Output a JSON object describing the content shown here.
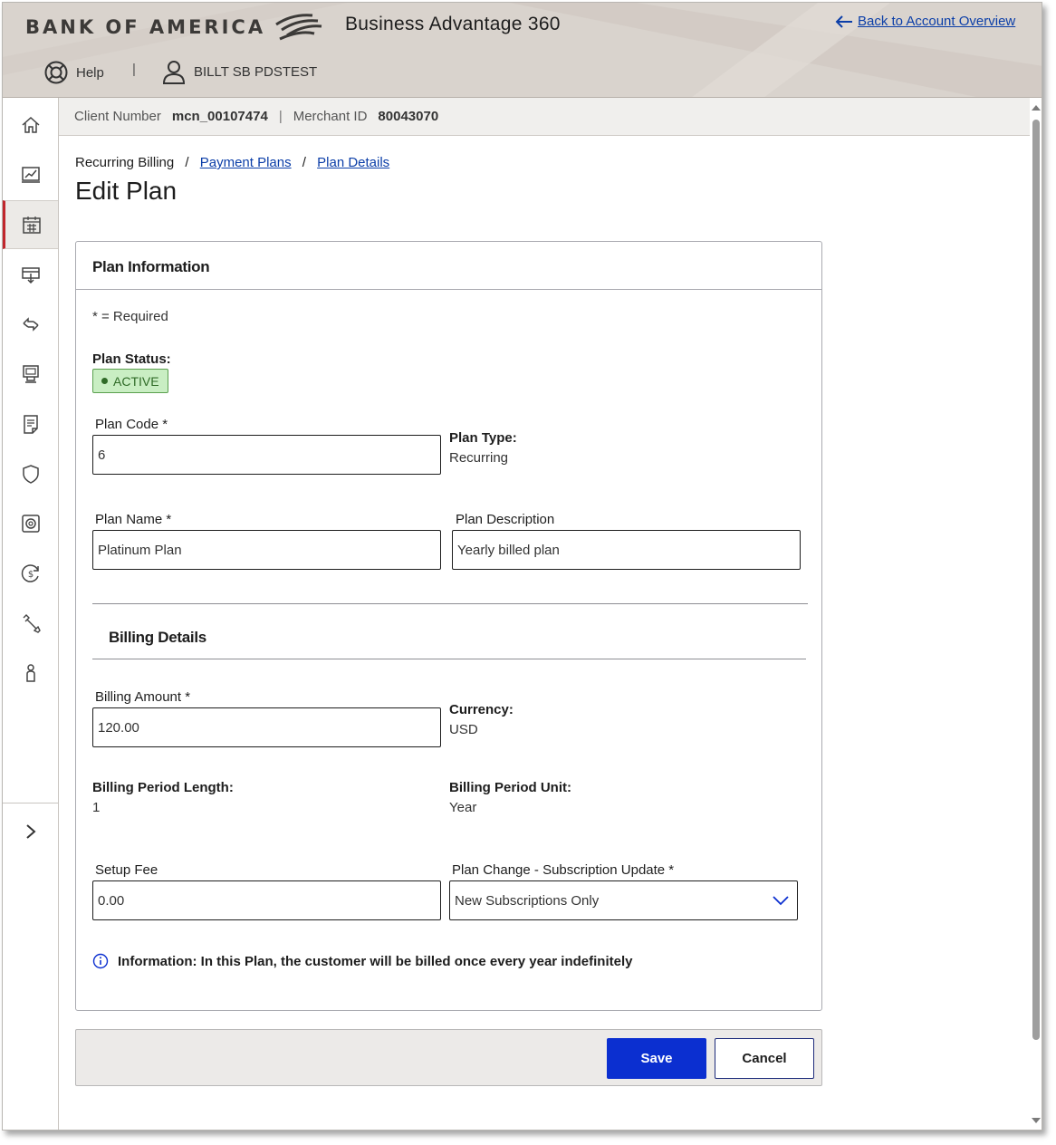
{
  "header": {
    "logo_text": "BANK OF AMERICA",
    "product_name": "Business Advantage 360",
    "back_link": "Back to Account Overview",
    "help_label": "Help",
    "separator": "|",
    "user_name": "BILLT SB PDSTEST"
  },
  "infobar": {
    "client_label": "Client Number",
    "client_value": "mcn_00107474",
    "separator": "|",
    "merchant_label": "Merchant ID",
    "merchant_value": "80043070"
  },
  "sidebar": {
    "items": [
      {
        "icon": "home-icon"
      },
      {
        "icon": "chart-icon"
      },
      {
        "icon": "calendar-icon",
        "active": true
      },
      {
        "icon": "deposit-icon"
      },
      {
        "icon": "transfer-icon"
      },
      {
        "icon": "terminal-icon"
      },
      {
        "icon": "document-icon"
      },
      {
        "icon": "shield-icon"
      },
      {
        "icon": "safe-icon"
      },
      {
        "icon": "dollar-cycle-icon"
      },
      {
        "icon": "tools-icon"
      },
      {
        "icon": "person-icon"
      }
    ],
    "expand_icon": "chevron-right-icon"
  },
  "breadcrumb": {
    "root": "Recurring Billing",
    "separator": "/",
    "payment_plans": "Payment Plans",
    "plan_details": "Plan Details"
  },
  "page_title": "Edit Plan",
  "plan_info": {
    "title": "Plan Information",
    "required_note": "* = Required",
    "status_label": "Plan Status:",
    "status_value": "ACTIVE",
    "plan_code_label": "Plan Code *",
    "plan_code_value": "6",
    "plan_type_label": "Plan Type:",
    "plan_type_value": "Recurring",
    "plan_name_label": "Plan Name *",
    "plan_name_value": "Platinum Plan",
    "plan_desc_label": "Plan Description",
    "plan_desc_value": "Yearly billed plan"
  },
  "billing": {
    "title": "Billing Details",
    "amount_label": "Billing Amount *",
    "amount_value": "120.00",
    "currency_label": "Currency:",
    "currency_value": "USD",
    "period_length_label": "Billing Period Length:",
    "period_length_value": "1",
    "period_unit_label": "Billing Period Unit:",
    "period_unit_value": "Year",
    "setup_fee_label": "Setup Fee",
    "setup_fee_value": "0.00",
    "plan_change_label": "Plan Change - Subscription Update *",
    "plan_change_value": "New Subscriptions Only",
    "info_text": "Information: In this Plan, the customer will be billed once every year indefinitely"
  },
  "actions": {
    "save": "Save",
    "cancel": "Cancel"
  },
  "colors": {
    "brand_blue": "#0b2fd0",
    "link_blue": "#0b3ea8",
    "active_red": "#c1272d",
    "status_green_bg": "#c9eec3",
    "status_green_text": "#2f6b27"
  }
}
